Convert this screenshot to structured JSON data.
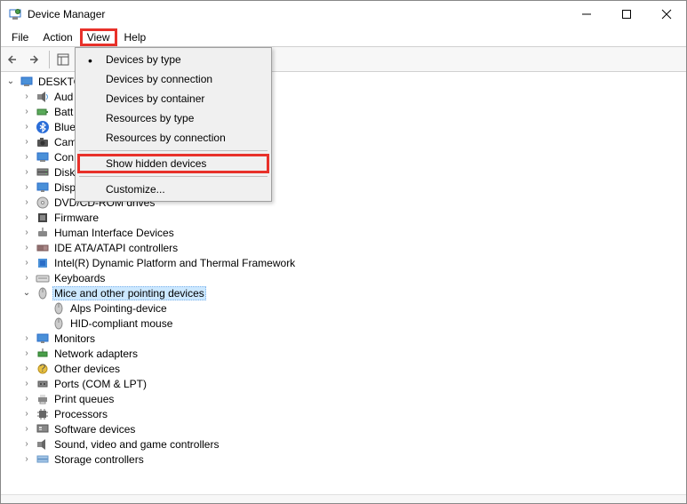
{
  "window": {
    "title": "Device Manager"
  },
  "menubar": {
    "file": "File",
    "action": "Action",
    "view": "View",
    "help": "Help"
  },
  "dropdown": {
    "items": [
      {
        "label": "Devices by type",
        "checked": true
      },
      {
        "label": "Devices by connection"
      },
      {
        "label": "Devices by container"
      },
      {
        "label": "Resources by type"
      },
      {
        "label": "Resources by connection"
      },
      {
        "label": "Show hidden devices",
        "highlighted": true
      },
      {
        "label": "Customize..."
      }
    ]
  },
  "tree": {
    "root": "DESKTO",
    "nodes": [
      {
        "label": "Aud",
        "icon": "audio"
      },
      {
        "label": "Batt",
        "icon": "battery"
      },
      {
        "label": "Blue",
        "icon": "bluetooth"
      },
      {
        "label": "Cam",
        "icon": "camera"
      },
      {
        "label": "Con",
        "icon": "computer"
      },
      {
        "label": "Disk",
        "icon": "disk"
      },
      {
        "label": "Disp",
        "icon": "display"
      },
      {
        "label": "DVD/CD-ROM drives",
        "icon": "dvd"
      },
      {
        "label": "Firmware",
        "icon": "firmware"
      },
      {
        "label": "Human Interface Devices",
        "icon": "hid"
      },
      {
        "label": "IDE ATA/ATAPI controllers",
        "icon": "ide"
      },
      {
        "label": "Intel(R) Dynamic Platform and Thermal Framework",
        "icon": "intel"
      },
      {
        "label": "Keyboards",
        "icon": "keyboard"
      },
      {
        "label": "Mice and other pointing devices",
        "icon": "mouse",
        "expanded": true,
        "selected": true,
        "children": [
          {
            "label": "Alps Pointing-device",
            "icon": "mouse"
          },
          {
            "label": "HID-compliant mouse",
            "icon": "mouse"
          }
        ]
      },
      {
        "label": "Monitors",
        "icon": "monitor"
      },
      {
        "label": "Network adapters",
        "icon": "network"
      },
      {
        "label": "Other devices",
        "icon": "other"
      },
      {
        "label": "Ports (COM & LPT)",
        "icon": "port"
      },
      {
        "label": "Print queues",
        "icon": "printer"
      },
      {
        "label": "Processors",
        "icon": "processor"
      },
      {
        "label": "Software devices",
        "icon": "software"
      },
      {
        "label": "Sound, video and game controllers",
        "icon": "sound"
      },
      {
        "label": "Storage controllers",
        "icon": "storage"
      }
    ]
  }
}
